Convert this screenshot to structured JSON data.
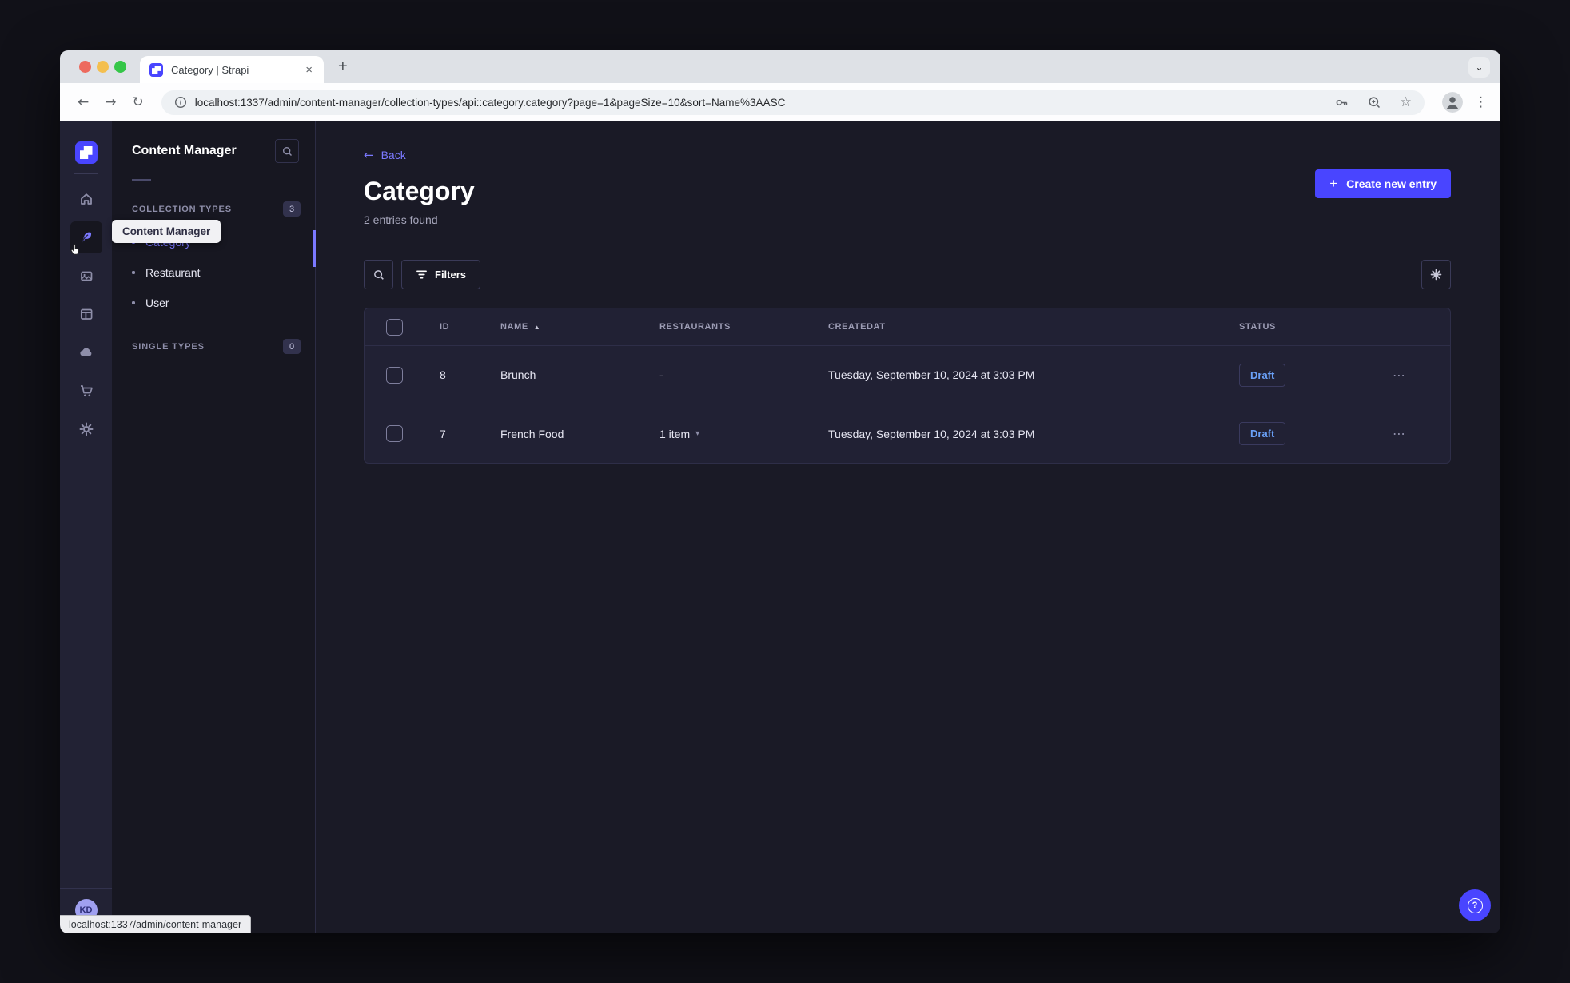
{
  "browser": {
    "tab_title": "Category | Strapi",
    "url": "localhost:1337/admin/content-manager/collection-types/api::category.category?page=1&pageSize=10&sort=Name%3AASC"
  },
  "glyphs": {
    "close": "×",
    "plus": "+",
    "chevron_down": "⌄",
    "back_arrow": "←",
    "forward_arrow": "→",
    "reload": "↻",
    "star": "☆",
    "kebab": "⋮",
    "sort_asc": "▲",
    "item_chevron": "▾",
    "ellipsis": "⋯",
    "question": "?"
  },
  "subnav": {
    "title": "Content Manager",
    "collection_label": "COLLECTION TYPES",
    "collection_count": "3",
    "single_label": "SINGLE TYPES",
    "single_count": "0",
    "items": [
      {
        "label": "Category"
      },
      {
        "label": "Restaurant"
      },
      {
        "label": "User"
      }
    ]
  },
  "tooltip": {
    "label": "Content Manager"
  },
  "main": {
    "back_label": "Back",
    "title": "Category",
    "subtitle": "2 entries found",
    "create_label": "Create new entry",
    "filters_label": "Filters"
  },
  "table": {
    "headers": {
      "id": "ID",
      "name": "NAME",
      "restaurants": "RESTAURANTS",
      "createdat": "CREATEDAT",
      "status": "STATUS"
    },
    "rows": [
      {
        "id": "8",
        "name": "Brunch",
        "restaurants": "-",
        "createdat": "Tuesday, September 10, 2024 at 3:03 PM",
        "status": "Draft"
      },
      {
        "id": "7",
        "name": "French Food",
        "restaurants": "1 item",
        "createdat": "Tuesday, September 10, 2024 at 3:03 PM",
        "status": "Draft"
      }
    ]
  },
  "avatar": {
    "initials": "KD"
  },
  "statusbar": {
    "text": "localhost:1337/admin/content-manager"
  },
  "colors": {
    "primary": "#4945ff",
    "link": "#7b79ff",
    "draft_text": "#6aa1f8"
  }
}
